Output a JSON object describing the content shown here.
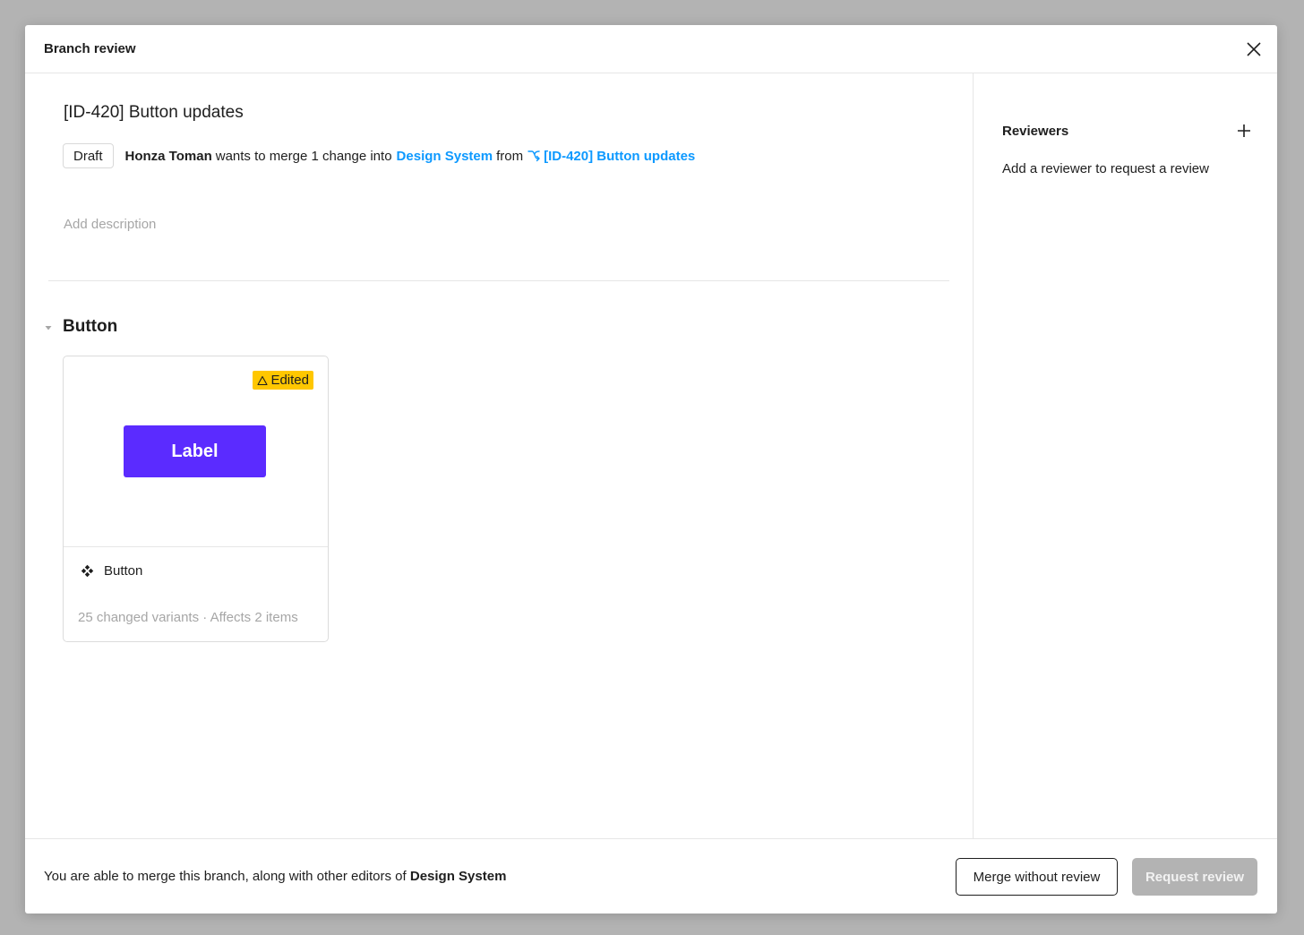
{
  "modal": {
    "title": "Branch review"
  },
  "branch": {
    "title": "[ID-420] Button updates",
    "status_badge": "Draft",
    "author": "Honza Toman",
    "merge_text": "wants to merge 1 change into",
    "target_file": "Design System",
    "from_text": "from",
    "source_branch": "[ID-420] Button updates",
    "description_placeholder": "Add description"
  },
  "section": {
    "title": "Button",
    "card": {
      "badge_label": "Edited",
      "preview_button_label": "Label",
      "component_name": "Button",
      "stats": "25 changed variants · Affects 2 items"
    }
  },
  "reviewers": {
    "title": "Reviewers",
    "hint": "Add a reviewer to request a review"
  },
  "footer": {
    "text_prefix": "You are able to merge this branch, along with other editors of",
    "file_name": "Design System",
    "merge_button": "Merge without review",
    "request_button": "Request review"
  },
  "icons": {
    "close": "close-icon",
    "branch": "branch-icon",
    "chevron": "chevron-down-icon",
    "warning": "warning-icon",
    "component": "component-icon",
    "add": "plus-icon"
  },
  "colors": {
    "link": "#0d99ff",
    "edited_badge": "#ffc700",
    "preview_button": "#5b2bff",
    "disabled_button": "#b3b3b3"
  }
}
